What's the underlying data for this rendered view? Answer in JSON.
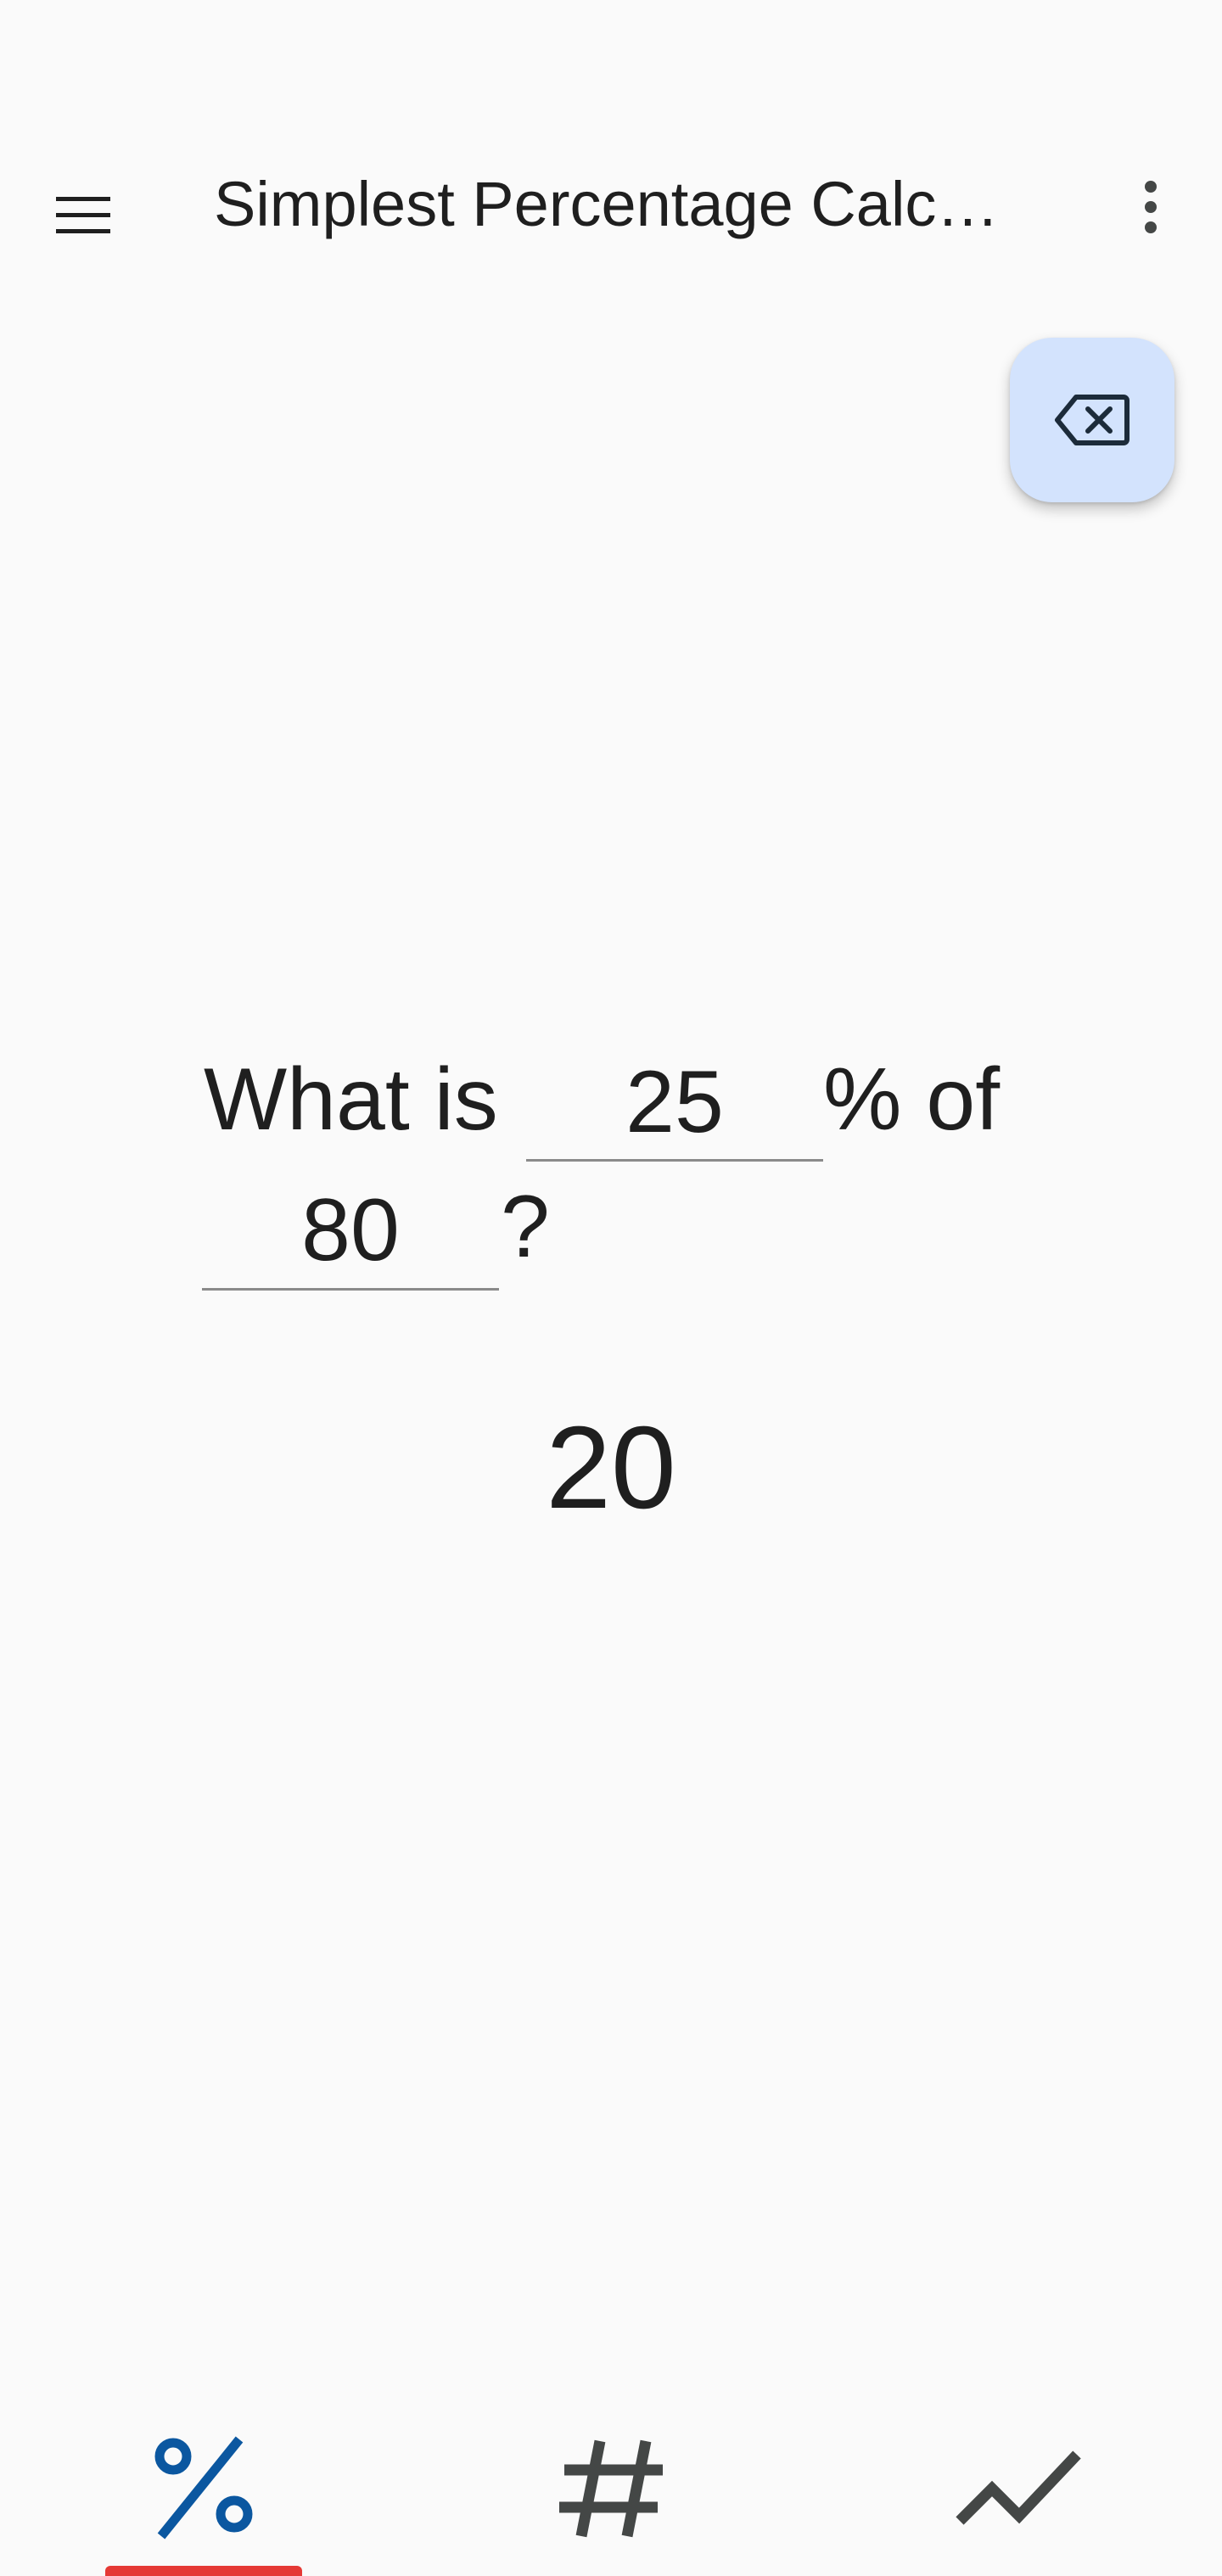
{
  "appbar": {
    "title": "Simplest Percentage Calculator",
    "menu_icon": "menu-icon",
    "overflow_icon": "more-vert-icon"
  },
  "fab": {
    "icon": "backspace-clear-icon",
    "color": "#d3e3fd"
  },
  "question": {
    "prefix": "What is",
    "percent_value": "25",
    "middle": "% of",
    "base_value": "80",
    "suffix": "?"
  },
  "result": {
    "value": "20"
  },
  "bottom_nav": {
    "tabs": [
      {
        "icon": "percent-icon",
        "active": true
      },
      {
        "icon": "hash-icon",
        "active": false
      },
      {
        "icon": "trending-icon",
        "active": false
      }
    ],
    "active_color": "#0b57a0",
    "inactive_color": "#444746",
    "indicator_color": "#e53935"
  }
}
